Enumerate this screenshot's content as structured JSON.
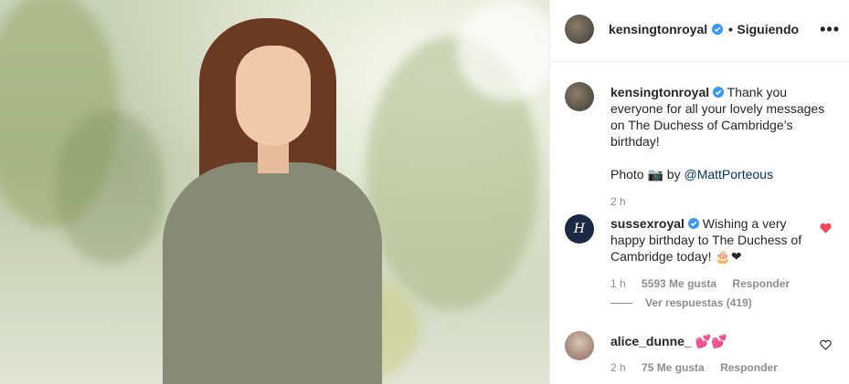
{
  "header": {
    "username": "kensingtonroyal",
    "follow_state": "Siguiendo",
    "more_label": "•••",
    "separator": "•"
  },
  "caption": {
    "username": "kensingtonroyal",
    "text": "Thank you everyone for all your lovely messages on The Duchess of Cambridge’s birthday!",
    "photo_credit_prefix": "Photo 📷 by ",
    "photo_credit_handle": "@MattPorteous",
    "time": "2 h"
  },
  "comments": [
    {
      "username": "sussexroyal",
      "text": "Wishing a very happy birthday to The Duchess of Cambridge today! 🎂❤",
      "time": "1 h",
      "likes": "5593 Me gusta",
      "reply_label": "Responder",
      "view_replies": "Ver respuestas (419)",
      "liked": true
    },
    {
      "username": "alice_dunne_",
      "text": "💕💕",
      "time": "2 h",
      "likes": "75 Me gusta",
      "reply_label": "Responder",
      "liked": false
    }
  ],
  "colors": {
    "verified": "#3897f0",
    "link": "#003569",
    "liked_heart": "#ed4956",
    "muted": "#8e8e8e"
  },
  "avatar_labels": {
    "sussex": "H"
  }
}
